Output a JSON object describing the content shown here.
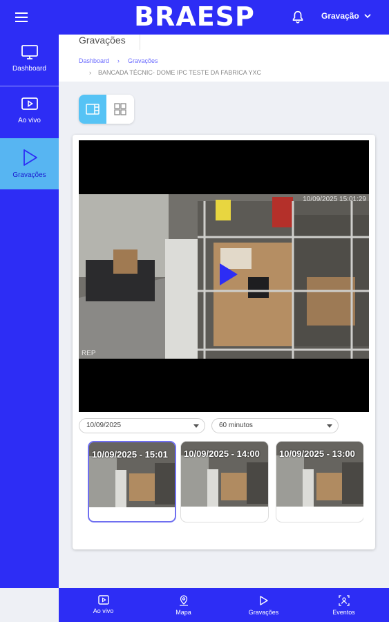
{
  "header": {
    "brand": "BRAESP",
    "user_menu": "Gravação"
  },
  "sidebar": {
    "items": [
      {
        "label": "Dashboard",
        "icon": "monitor-icon"
      },
      {
        "label": "Ao vivo",
        "icon": "play-square-icon"
      },
      {
        "label": "Gravações",
        "icon": "play-triangle-icon",
        "active": true
      }
    ]
  },
  "page": {
    "title": "Gravações",
    "breadcrumb": [
      "Dashboard",
      "Gravações"
    ],
    "camera_path": "BANCADA TÉCNIC- DOME IPC TESTE DA FABRICA YXC"
  },
  "player": {
    "timestamp": "10/09/2025 15:01:29",
    "corner_label": "REP"
  },
  "filters": {
    "date": "10/09/2025",
    "duration": "60 minutos"
  },
  "recordings": [
    {
      "label": "10/09/2025 - 15:01",
      "selected": true
    },
    {
      "label": "10/09/2025 - 14:00",
      "selected": false
    },
    {
      "label": "10/09/2025 - 13:00",
      "selected": false
    }
  ],
  "bottom_nav": [
    {
      "label": "Ao vivo",
      "icon": "play-square-icon"
    },
    {
      "label": "Mapa",
      "icon": "map-pin-icon"
    },
    {
      "label": "Gravações",
      "icon": "play-triangle-icon"
    },
    {
      "label": "Eventos",
      "icon": "events-icon"
    }
  ],
  "colors": {
    "primary": "#2d2df5",
    "accent": "#56c3f5",
    "highlight": "#6f6ff0"
  }
}
